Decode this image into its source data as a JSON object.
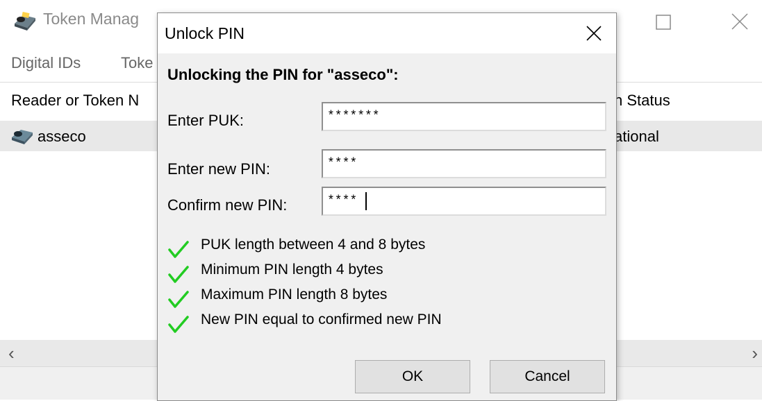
{
  "main_window": {
    "title": "Token Manag",
    "menu": [
      "Digital IDs",
      "Toke"
    ],
    "columns": {
      "reader": "Reader or Token N",
      "status": "n Status"
    },
    "row": {
      "name": "asseco",
      "status": "ational"
    },
    "scroll": {
      "left": "‹",
      "right": "›"
    }
  },
  "dialog": {
    "title": "Unlock PIN",
    "heading": "Unlocking the PIN for \"asseco\":",
    "fields": {
      "puk": {
        "label": "Enter PUK:",
        "value": "*******"
      },
      "new_pin": {
        "label": "Enter new PIN:",
        "value": "****"
      },
      "confirm_pin": {
        "label": "Confirm new PIN:",
        "value": "****"
      }
    },
    "rules": [
      "PUK length between 4 and 8 bytes",
      "Minimum PIN length 4 bytes",
      "Maximum PIN length 8 bytes",
      "New PIN equal to confirmed new PIN"
    ],
    "buttons": {
      "ok": "OK",
      "cancel": "Cancel"
    }
  },
  "icons": {
    "app": "token-reader-icon",
    "check": "check-icon",
    "close": "close-icon",
    "maximize": "maximize-icon"
  },
  "colors": {
    "check": "#22cc22",
    "row_highlight": "#e8e8e8"
  }
}
